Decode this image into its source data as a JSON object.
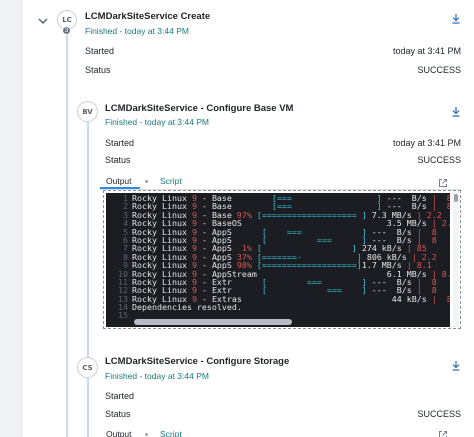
{
  "steps": [
    {
      "initials": "LC",
      "badge": "3",
      "title": "LCMDarkSiteService Create",
      "finished": "Finished - today at 3:44 PM",
      "started_label": "Started",
      "started_value": "today at 3:41 PM",
      "status_label": "Status",
      "status_value": "SUCCESS"
    },
    {
      "initials": "BV",
      "title": "LCMDarkSiteService - Configure Base VM",
      "finished": "Finished - today at 3:44 PM",
      "started_label": "Started",
      "started_value": "today at 3:41 PM",
      "status_label": "Status",
      "status_value": "SUCCESS",
      "tabs": [
        "Output",
        "Script"
      ]
    },
    {
      "initials": "CS",
      "title": "LCMDarkSiteService - Configure Storage",
      "finished": "Finished - today at 3:44 PM",
      "started_label": "Started",
      "started_value": "",
      "status_label": "Status",
      "status_value": "SUCCESS",
      "tabs": [
        "Output",
        "Script"
      ]
    }
  ],
  "terminal": {
    "lines": [
      {
        "n": "1",
        "name": "Rocky Linux ",
        "ver": "9",
        "repo": " - Base     ",
        "pct": "   ",
        "bar": "[===                 ]",
        "rate": " ---  B/s",
        "tail": " |  8"
      },
      {
        "n": "2",
        "name": "Rocky Linux ",
        "ver": "9",
        "repo": " - Base     ",
        "pct": "   ",
        "bar": "[===                 ]",
        "rate": " ---  B/s",
        "tail": " |  8"
      },
      {
        "n": "3",
        "name": "Rocky Linux ",
        "ver": "9",
        "repo": " - Base ",
        "pct": "97%",
        "bar": " [=================== ]",
        "rate": " 7.3 MB/s",
        "tail": " | 2.2"
      },
      {
        "n": "4",
        "name": "Rocky Linux ",
        "ver": "9",
        "repo": " - BaseOS   ",
        "pct": "   ",
        "bar": "                      ",
        "rate": " 3.5 MB/s",
        "tail": " | 2.2"
      },
      {
        "n": "5",
        "name": "Rocky Linux ",
        "ver": "9",
        "repo": " - AppS   ",
        "pct": "   ",
        "bar": "[    ===            ]",
        "rate": " ---  B/s",
        "tail": " |  8"
      },
      {
        "n": "6",
        "name": "Rocky Linux ",
        "ver": "9",
        "repo": " - AppS   ",
        "pct": "   ",
        "bar": "[          ===      ]",
        "rate": " ---  B/s",
        "tail": " |  8"
      },
      {
        "n": "7",
        "name": "Rocky Linux ",
        "ver": "9",
        "repo": " - AppS ",
        "pct": " 1%",
        "bar": " [                  ]",
        "rate": " 274 kB/s",
        "tail": " | 85"
      },
      {
        "n": "8",
        "name": "Rocky Linux ",
        "ver": "9",
        "repo": " - AppS ",
        "pct": "37%",
        "bar": " [=======-           ]",
        "rate": " 806 kB/s",
        "tail": " | 2.2"
      },
      {
        "n": "9",
        "name": "Rocky Linux ",
        "ver": "9",
        "repo": " - AppS ",
        "pct": "98%",
        "bar": " [===================]",
        "rate": "1.7 MB/s",
        "tail": " | 8.1"
      },
      {
        "n": "10",
        "name": "Rocky Linux ",
        "ver": "9",
        "repo": " - AppStream",
        "pct": "   ",
        "bar": "                      ",
        "rate": " 6.1 MB/s",
        "tail": " | 8.1"
      },
      {
        "n": "11",
        "name": "Rocky Linux ",
        "ver": "9",
        "repo": " - Extr   ",
        "pct": "   ",
        "bar": "[        ===        ]",
        "rate": " ---  B/s",
        "tail": " |  8"
      },
      {
        "n": "12",
        "name": "Rocky Linux ",
        "ver": "9",
        "repo": " - Extr   ",
        "pct": "   ",
        "bar": "[            ===    ]",
        "rate": " ---  B/s",
        "tail": " |  8"
      },
      {
        "n": "13",
        "name": "Rocky Linux ",
        "ver": "9",
        "repo": " - Extras   ",
        "pct": "   ",
        "bar": "                      ",
        "rate": "  44 kB/s",
        "tail": " |  8"
      },
      {
        "n": "14",
        "name": "Dependencies resolved.",
        "ver": "",
        "repo": "",
        "pct": "",
        "bar": "",
        "rate": "",
        "tail": ""
      },
      {
        "n": "15",
        "name": "",
        "ver": "",
        "repo": "",
        "pct": "",
        "bar": "",
        "rate": "",
        "tail": ""
      }
    ]
  },
  "icons": {
    "collapse": "chevron-down-icon",
    "download": "download-icon",
    "expand": "external-link-icon"
  },
  "colors": {
    "accent": "#2c8ee3",
    "finished_text": "#1a7a7c",
    "terminal_bg": "#1b1d22",
    "terminal_red": "#e0534f",
    "terminal_cyan": "#37c3d8"
  }
}
